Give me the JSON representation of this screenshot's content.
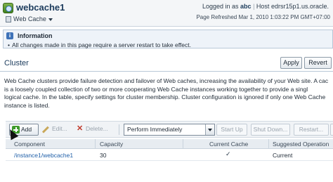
{
  "header": {
    "app_title": "webcache1",
    "target_menu": "Web Cache",
    "logged_in_prefix": "Logged in as",
    "user": "abc",
    "host_prefix": "Host",
    "host": "edrsr15p1.us.oracle.",
    "page_refreshed": "Page Refreshed Mar 1, 2010 1:03:22 PM GMT+07:00"
  },
  "info": {
    "title": "Information",
    "message": "All changes made in this page require a server restart to take effect."
  },
  "section": {
    "title": "Cluster",
    "apply_label": "Apply",
    "revert_label": "Revert"
  },
  "description": {
    "line1": "Web Cache clusters provide failure detection and failover of Web caches, increasing the availability of your Web site. A cac",
    "line2": "is a loosely coupled collection of two or more cooperating Web Cache instances working together to provide a singl",
    "line3": "logical cache. In the table, specify settings for cluster membership. Cluster configuration is ignored if only one Web Cache",
    "line4": "instance is listed."
  },
  "toolbar": {
    "add_label": "Add",
    "edit_label": "Edit...",
    "delete_label": "Delete...",
    "mode_selected": "Perform Immediately",
    "startup_label": "Start Up",
    "shutdown_label": "Shut Down...",
    "restart_label": "Restart..."
  },
  "table": {
    "columns": [
      "Component",
      "Capacity",
      "Current Cache",
      "Suggested Operation"
    ],
    "rows": [
      {
        "component": "/instance1/webcache1",
        "capacity": "30",
        "current_cache": "✓",
        "suggested_operation": "Current"
      }
    ]
  },
  "colors": {
    "accent": "#1b3b5c",
    "link": "#1f5fa8",
    "info_bg": "#eef3f9",
    "delete_red": "#c03a2b",
    "add_green": "#3e9a2a"
  }
}
